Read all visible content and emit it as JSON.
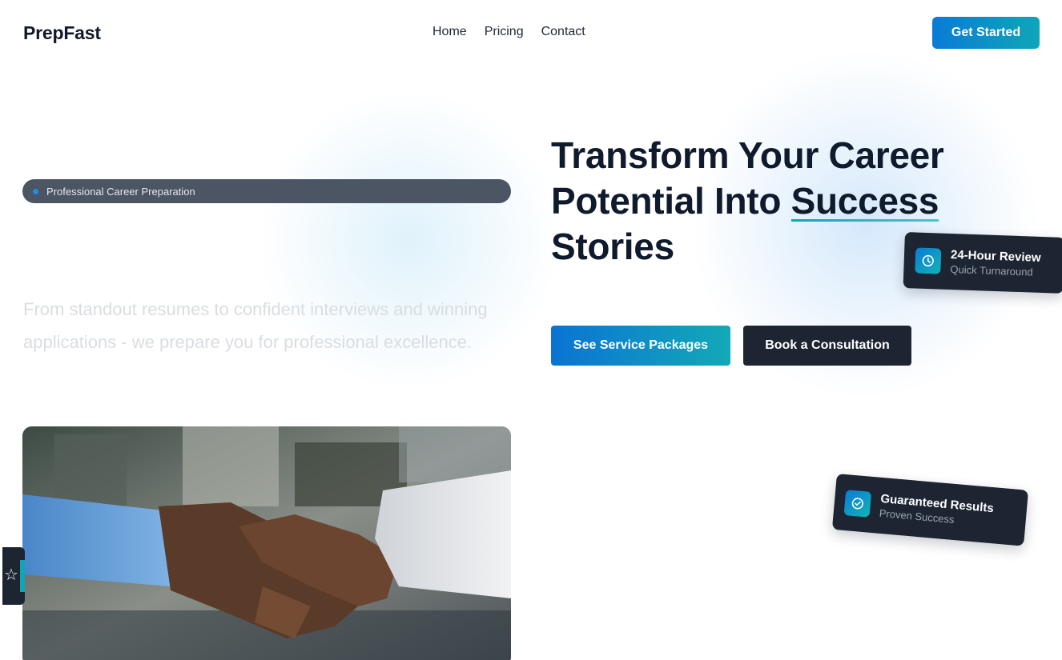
{
  "nav": {
    "brand": "PrepFast",
    "links": [
      "Home",
      "Pricing",
      "Contact"
    ],
    "cta_label": "Get Started"
  },
  "hero": {
    "pill_label": "Professional Career Preparation",
    "title_before": "Transform Your Career Potential Into ",
    "title_highlight": "Success",
    "title_after": " Stories",
    "subtitle": "From standout resumes to confident interviews and winning applications - we prepare you for professional excellence.",
    "primary_button": "See Service Packages",
    "secondary_button": "Book a Consultation",
    "image_icon": "handshake-photo"
  },
  "badges": [
    {
      "title": "24-Hour Review",
      "subtitle": "Quick Turnaround",
      "icon": "clock-icon"
    },
    {
      "title": "Guaranteed Results",
      "subtitle": "Proven Success",
      "icon": "check-circle-icon"
    }
  ],
  "side_tab": {
    "icon": "star-icon"
  },
  "colors": {
    "accent_blue": "#0a7bd6",
    "accent_teal": "#12b3b6",
    "dark_surface": "#1e2532",
    "heading": "#0f1a2c"
  }
}
